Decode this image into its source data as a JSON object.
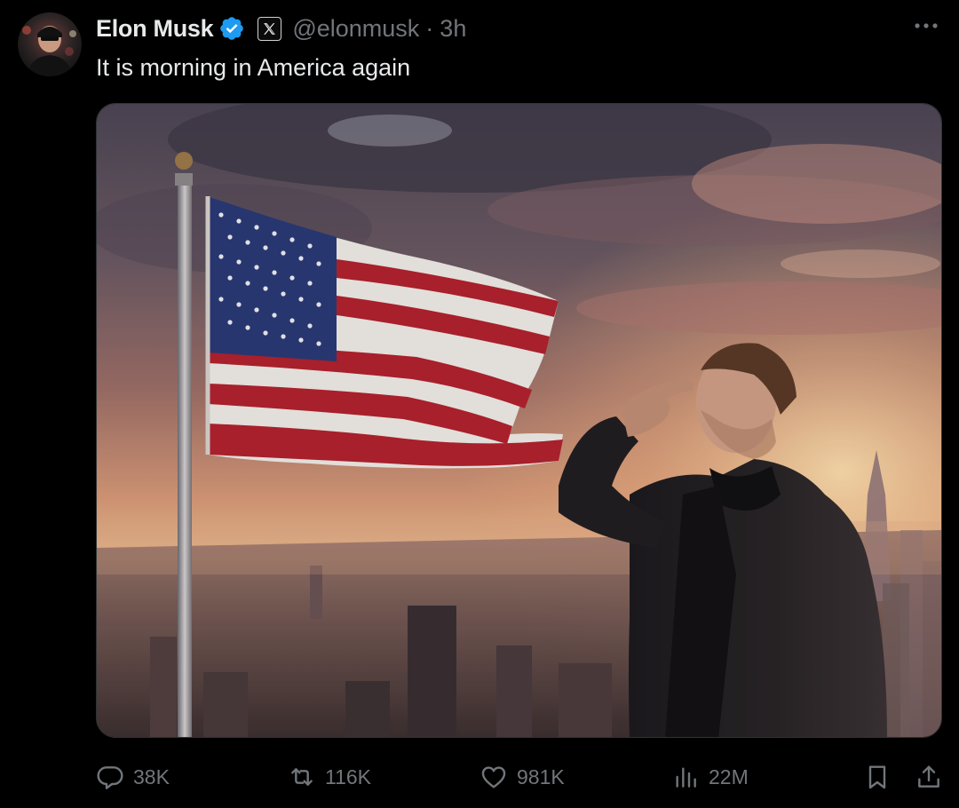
{
  "author": {
    "display_name": "Elon Musk",
    "handle": "@elonmusk",
    "separator": "·",
    "time_ago": "3h",
    "verified": true,
    "affiliation_badge": "X"
  },
  "tweet": {
    "text": "It is morning in America again"
  },
  "media": {
    "description_icon": "image"
  },
  "actions": {
    "replies": "38K",
    "reposts": "116K",
    "likes": "981K",
    "views": "22M"
  },
  "colors": {
    "background": "#000000",
    "text_primary": "#e7e9ea",
    "text_secondary": "#71767b",
    "verified_blue": "#1d9bf0"
  }
}
